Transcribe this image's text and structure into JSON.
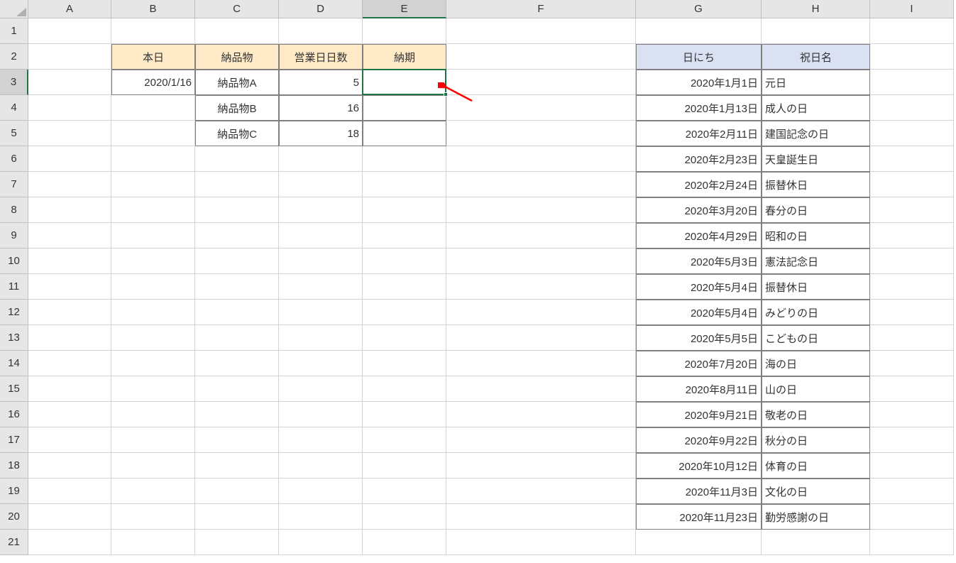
{
  "columns": [
    "A",
    "B",
    "C",
    "D",
    "E",
    "F",
    "G",
    "H",
    "I"
  ],
  "selected_column": "E",
  "selected_row": 3,
  "row_count": 21,
  "headers_left": {
    "B2": "本日",
    "C2": "納品物",
    "D2": "営業日日数",
    "E2": "納期"
  },
  "data_left": {
    "B3": "2020/1/16",
    "C3": "納品物A",
    "D3": "5",
    "C4": "納品物B",
    "D4": "16",
    "C5": "納品物C",
    "D5": "18"
  },
  "headers_right": {
    "G2": "日にち",
    "H2": "祝日名"
  },
  "holidays": [
    {
      "date": "2020年1月1日",
      "name": "元日"
    },
    {
      "date": "2020年1月13日",
      "name": "成人の日"
    },
    {
      "date": "2020年2月11日",
      "name": "建国記念の日"
    },
    {
      "date": "2020年2月23日",
      "name": "天皇誕生日"
    },
    {
      "date": "2020年2月24日",
      "name": "振替休日"
    },
    {
      "date": "2020年3月20日",
      "name": "春分の日"
    },
    {
      "date": "2020年4月29日",
      "name": "昭和の日"
    },
    {
      "date": "2020年5月3日",
      "name": "憲法記念日"
    },
    {
      "date": "2020年5月4日",
      "name": "振替休日"
    },
    {
      "date": "2020年5月4日",
      "name": "みどりの日"
    },
    {
      "date": "2020年5月5日",
      "name": "こどもの日"
    },
    {
      "date": "2020年7月20日",
      "name": "海の日"
    },
    {
      "date": "2020年8月11日",
      "name": "山の日"
    },
    {
      "date": "2020年9月21日",
      "name": "敬老の日"
    },
    {
      "date": "2020年9月22日",
      "name": "秋分の日"
    },
    {
      "date": "2020年10月12日",
      "name": "体育の日"
    },
    {
      "date": "2020年11月3日",
      "name": "文化の日"
    },
    {
      "date": "2020年11月23日",
      "name": "勤労感謝の日"
    }
  ]
}
